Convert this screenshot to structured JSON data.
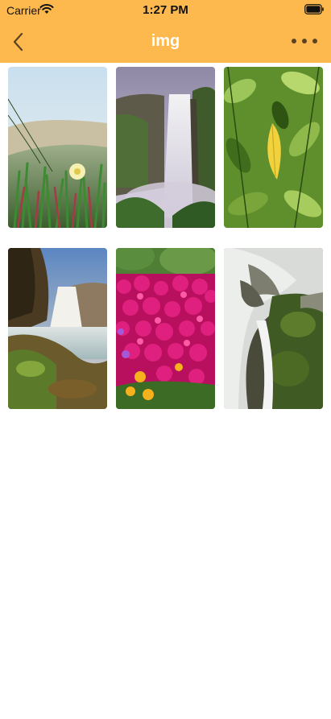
{
  "status_bar": {
    "carrier": "Carrier",
    "time": "1:27 PM",
    "icons": [
      "wifi-icon",
      "battery-icon"
    ]
  },
  "nav": {
    "title": "img",
    "back_icon": "chevron-left-icon",
    "more_icon": "more-horizontal-icon"
  },
  "colors": {
    "header": "#fdb94d",
    "title": "#ffffff"
  },
  "gallery": {
    "images": [
      {
        "subject": "ice plant flowers with white blossom"
      },
      {
        "subject": "waterfall on green cliff"
      },
      {
        "subject": "green leaves with yellow leaf"
      },
      {
        "subject": "waterfall at sunset with rocky shore"
      },
      {
        "subject": "magenta flower field with yellow poppies"
      },
      {
        "subject": "cascading waterfall over mossy rocks"
      }
    ]
  }
}
